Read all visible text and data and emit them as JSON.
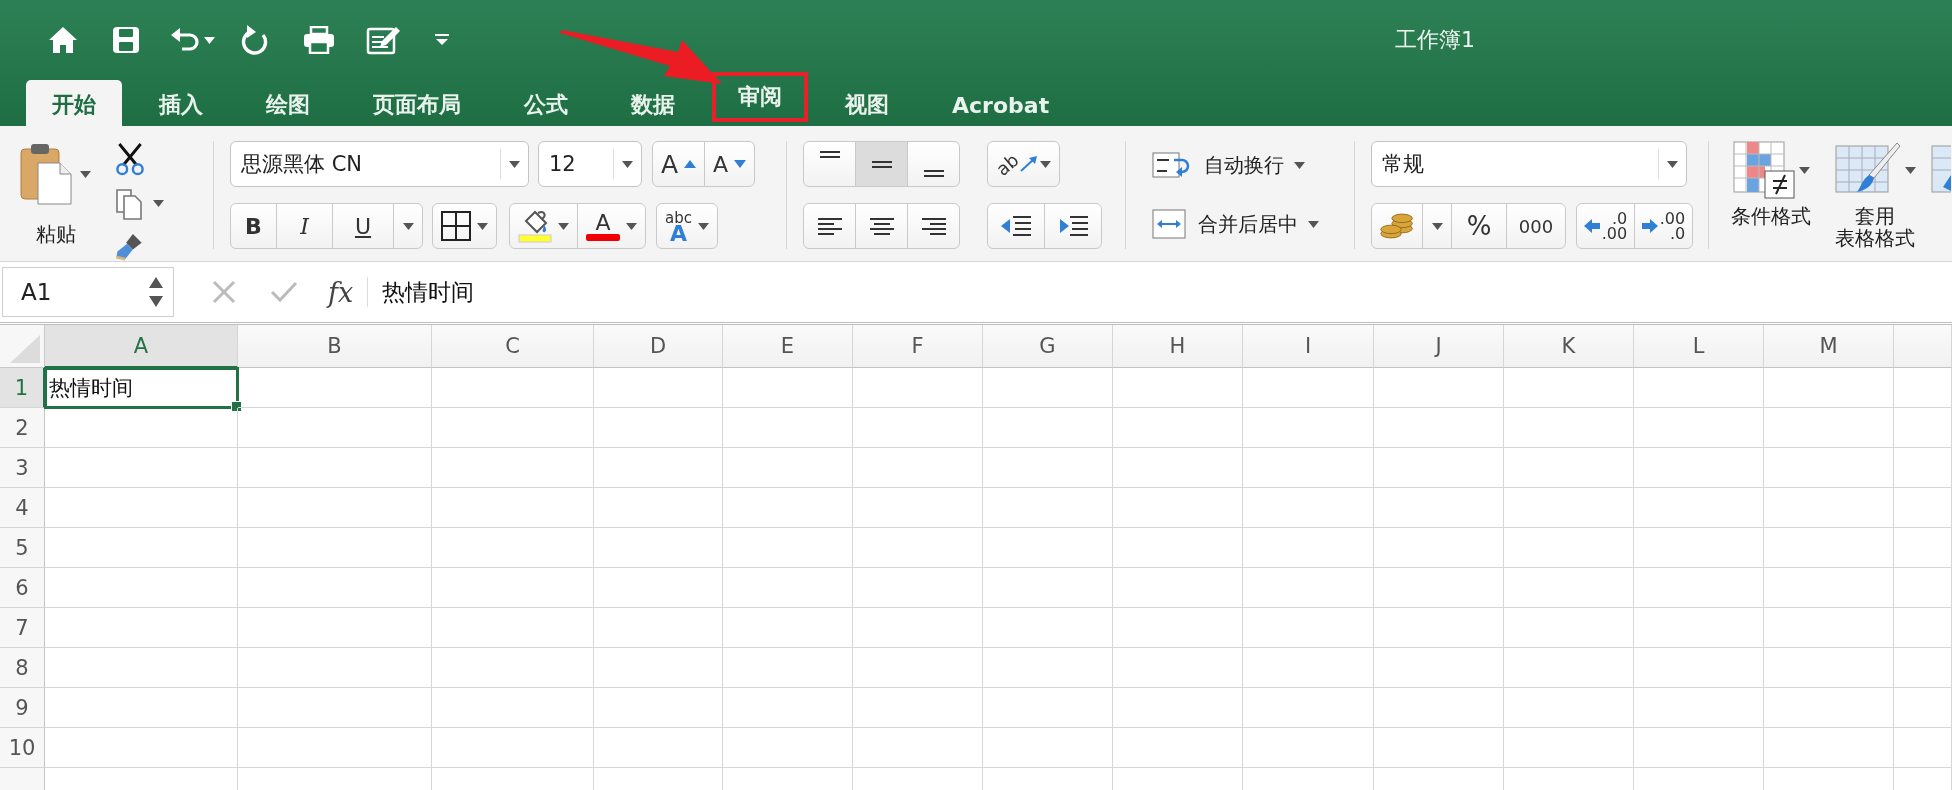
{
  "window": {
    "title": "工作簿1"
  },
  "ribbon_tabs": [
    {
      "label": "开始",
      "selected": true,
      "highlighted": false
    },
    {
      "label": "插入",
      "selected": false,
      "highlighted": false
    },
    {
      "label": "绘图",
      "selected": false,
      "highlighted": false
    },
    {
      "label": "页面布局",
      "selected": false,
      "highlighted": false
    },
    {
      "label": "公式",
      "selected": false,
      "highlighted": false
    },
    {
      "label": "数据",
      "selected": false,
      "highlighted": false
    },
    {
      "label": "审阅",
      "selected": false,
      "highlighted": true
    },
    {
      "label": "视图",
      "selected": false,
      "highlighted": false
    },
    {
      "label": "Acrobat",
      "selected": false,
      "highlighted": false
    }
  ],
  "clipboard": {
    "paste": "粘贴"
  },
  "font": {
    "name": "思源黑体 CN",
    "size": "12",
    "grow": "A",
    "shrink": "A",
    "bold": "B",
    "italic": "I",
    "underline": "U",
    "font_color": "A",
    "text_style": [
      "abc",
      "A"
    ]
  },
  "alignment": {
    "vertical": [
      {
        "selected": false
      },
      {
        "selected": true
      },
      {
        "selected": false
      }
    ],
    "orientation": "ab",
    "horizontal": [
      {
        "selected": false
      },
      {
        "selected": false
      },
      {
        "selected": false
      }
    ]
  },
  "wrap_text": "自动换行",
  "merge_center": "合并后居中",
  "number": {
    "format": "常规",
    "percent": "%",
    "thousands": "000",
    "increase_decimal": [
      ".0",
      ".00"
    ],
    "decrease_decimal": [
      ".00",
      ".0"
    ]
  },
  "styles": [
    {
      "kind": "conditional",
      "lines": [
        "条件格式"
      ]
    },
    {
      "kind": "table",
      "lines": [
        "套用",
        "表格格式"
      ]
    }
  ],
  "formula_bar": {
    "name_box": "A1",
    "function": "fx",
    "content": "热情时间"
  },
  "columns": [
    {
      "label": "A",
      "selected": true
    },
    {
      "label": "B",
      "selected": false
    },
    {
      "label": "C",
      "selected": false
    },
    {
      "label": "D",
      "selected": false
    },
    {
      "label": "E",
      "selected": false
    },
    {
      "label": "F",
      "selected": false
    },
    {
      "label": "G",
      "selected": false
    },
    {
      "label": "H",
      "selected": false
    },
    {
      "label": "I",
      "selected": false
    },
    {
      "label": "J",
      "selected": false
    },
    {
      "label": "K",
      "selected": false
    },
    {
      "label": "L",
      "selected": false
    },
    {
      "label": "M",
      "selected": false
    }
  ],
  "rows": [
    {
      "label": "1",
      "selected": true,
      "cells": [
        {
          "text": "热情时间",
          "selected": true
        }
      ]
    },
    {
      "label": "2",
      "selected": false
    },
    {
      "label": "3",
      "selected": false
    },
    {
      "label": "4",
      "selected": false
    },
    {
      "label": "5",
      "selected": false
    },
    {
      "label": "6",
      "selected": false
    },
    {
      "label": "7",
      "selected": false
    },
    {
      "label": "8",
      "selected": false
    },
    {
      "label": "9",
      "selected": false
    },
    {
      "label": "10",
      "selected": false
    }
  ]
}
